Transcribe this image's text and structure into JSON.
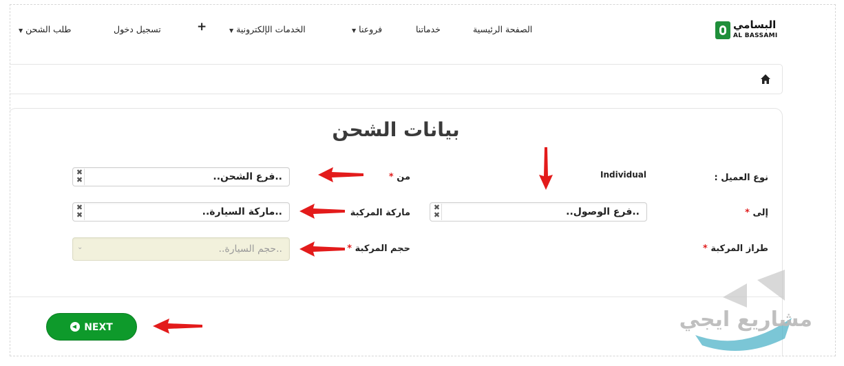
{
  "nav": {
    "logo_ar": "البسامي",
    "logo_en": "AL BASSAMI",
    "items": [
      {
        "label": "الصفحة الرئيسية",
        "dropdown": false
      },
      {
        "label": "خدماتنا",
        "dropdown": false
      },
      {
        "label": "فروعنا",
        "dropdown": true
      },
      {
        "label": "الخدمات الإلكترونية",
        "dropdown": true
      },
      {
        "label": "+",
        "dropdown": false
      },
      {
        "label": "تسجيل دخول",
        "dropdown": false
      },
      {
        "label": "طلب الشحن",
        "dropdown": true
      }
    ]
  },
  "form": {
    "title": "بيانات الشحن",
    "customer_type_label": "نوع العميل :",
    "customer_type_value": "Individual",
    "from_label": "من",
    "from_placeholder": "..فرع الشحن..",
    "to_label": "إلى",
    "to_placeholder": "..فرع الوصول..",
    "brand_label": "ماركة المركبة",
    "brand_placeholder": "..ماركة السيارة..",
    "model_label": "طراز المركبة",
    "size_label": "حجم المركبة",
    "size_placeholder": "..حجم السيارة..",
    "required_mark": "*",
    "clear_glyph": "✖",
    "chevron_glyph": "⌄"
  },
  "actions": {
    "next_label": "NEXT"
  },
  "watermark": {
    "text": "مشاريع ايجي"
  },
  "colors": {
    "brand_green": "#0e9a2b",
    "required_red": "#e01e1e",
    "annotation_arrow": "#e31b1b",
    "disabled_bg": "#f2f1dc"
  }
}
